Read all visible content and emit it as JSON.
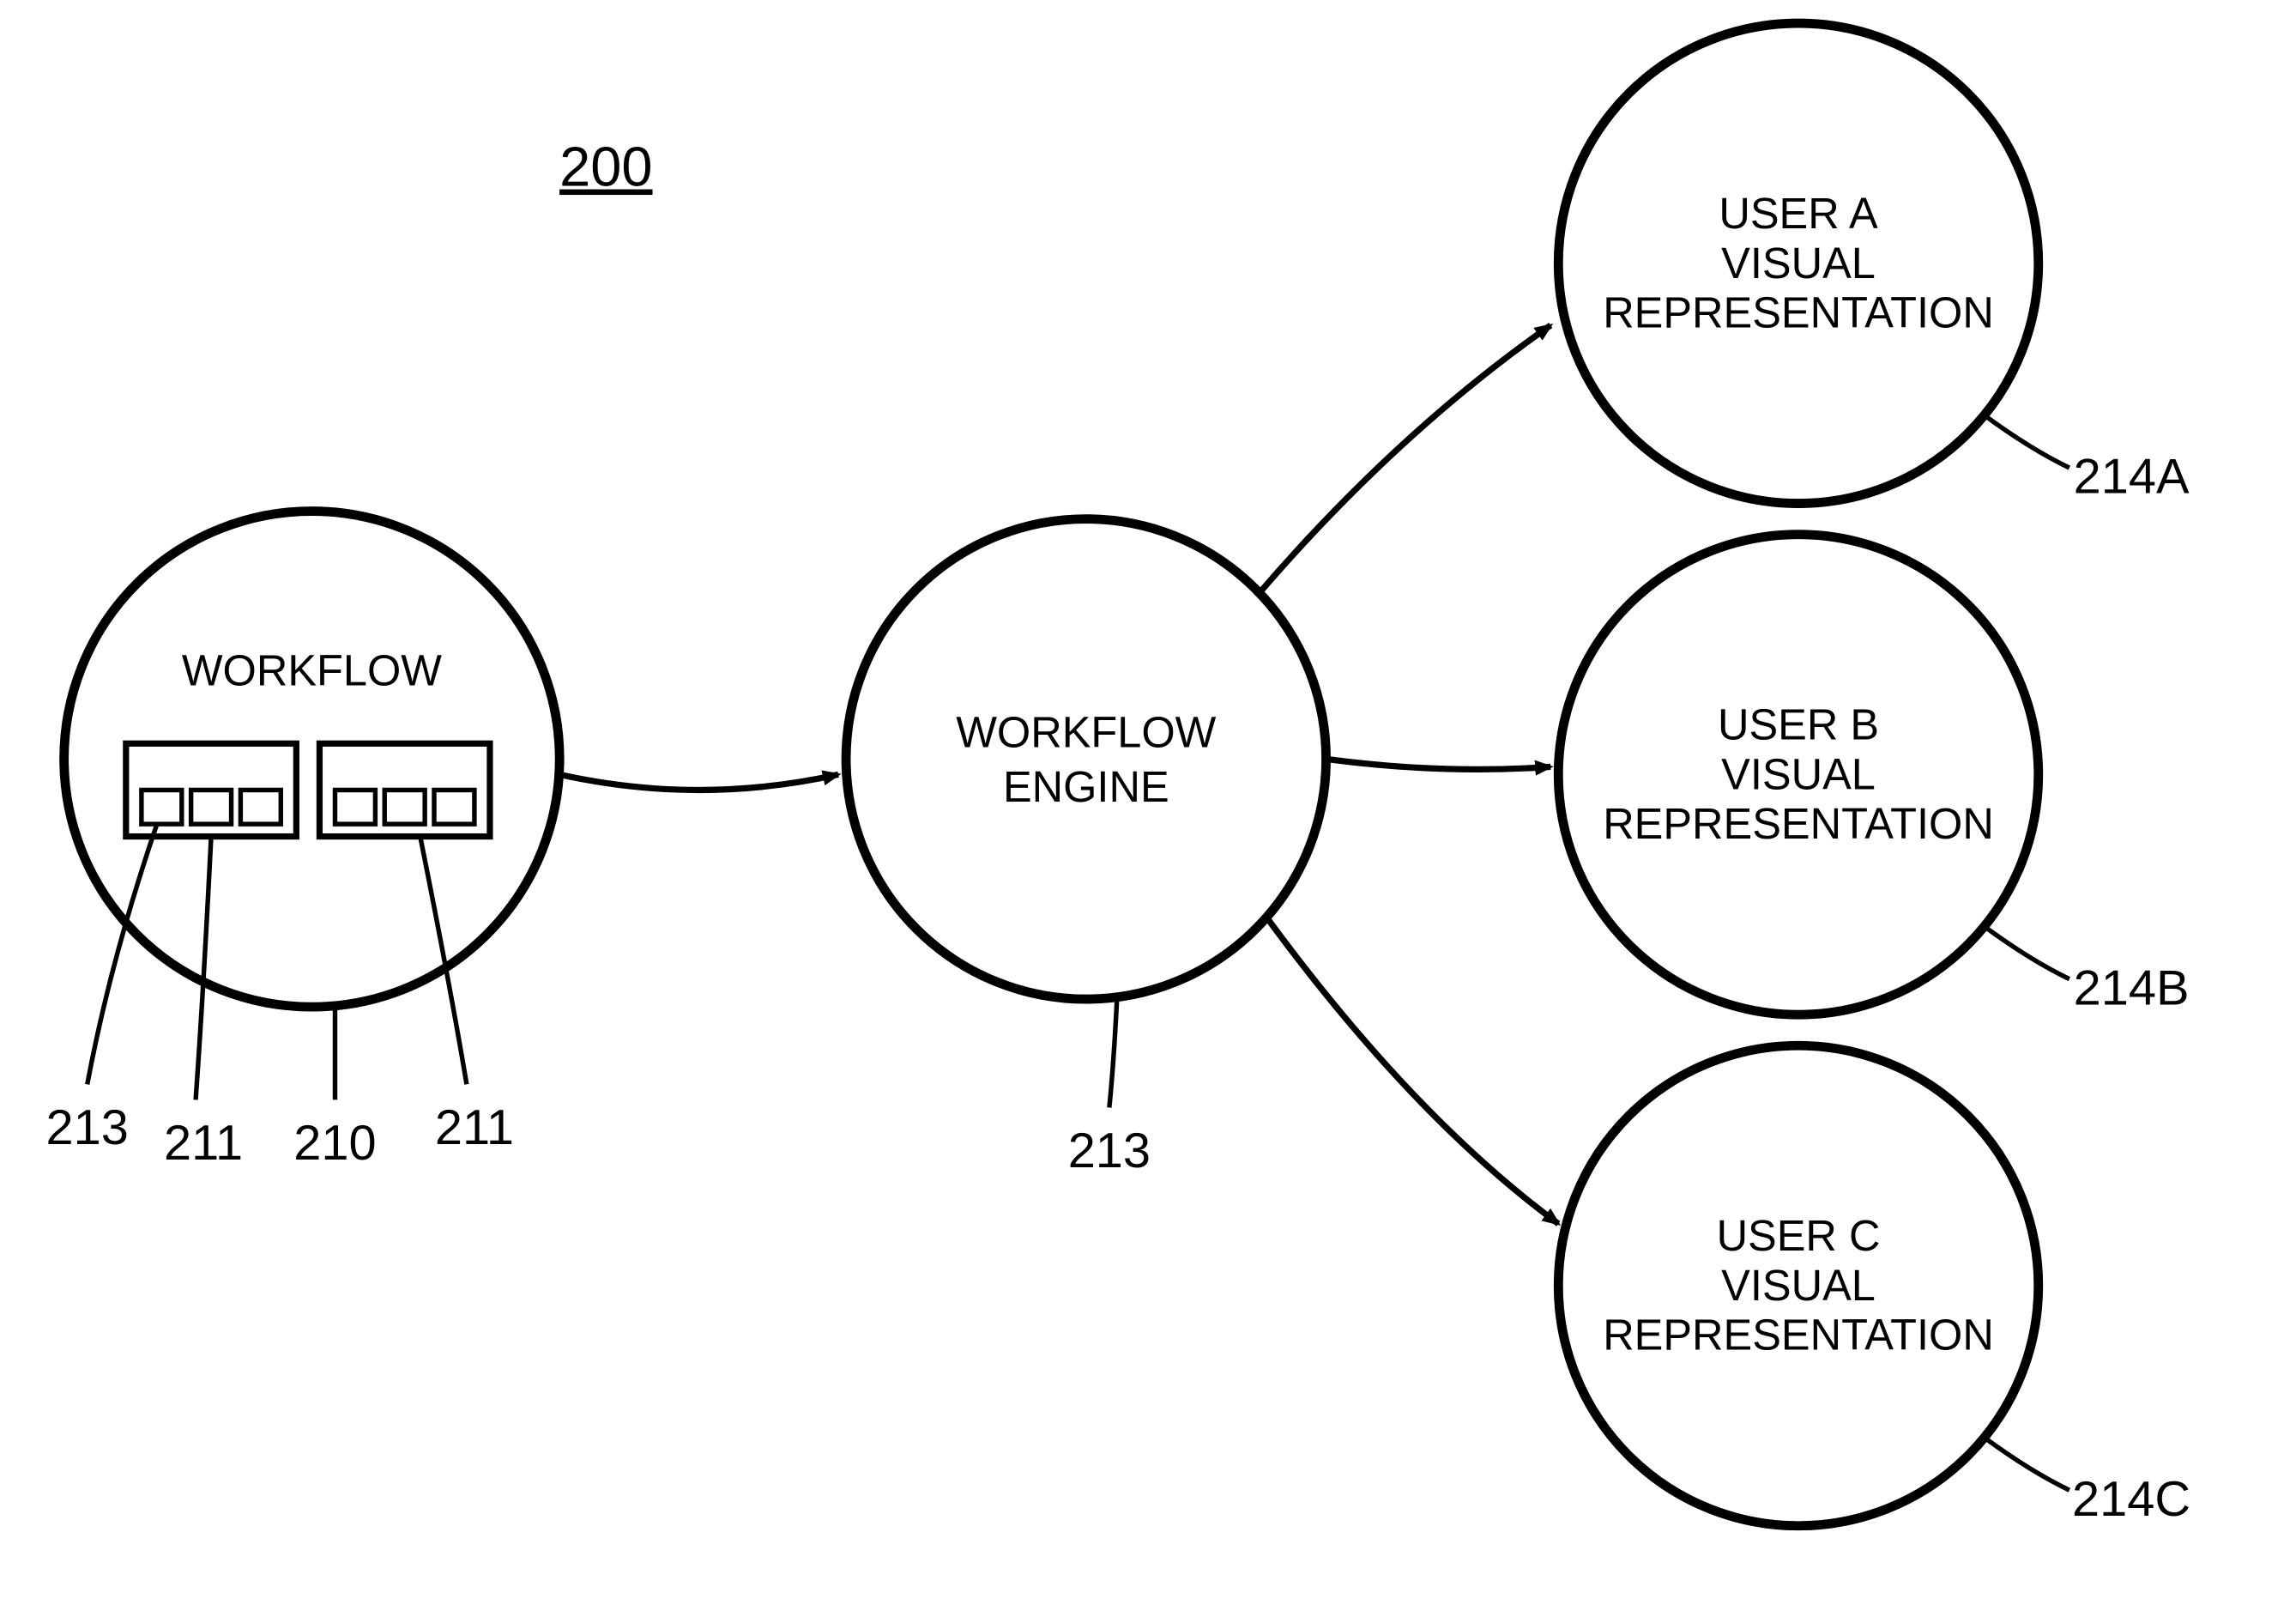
{
  "figure_number": "200",
  "nodes": {
    "workflow": {
      "label": "WORKFLOW",
      "ref_bubble": "210"
    },
    "engine": {
      "label_l1": "WORKFLOW",
      "label_l2": "ENGINE",
      "ref": "213"
    },
    "userA": {
      "l1": "USER A",
      "l2": "VISUAL",
      "l3": "REPRESENTATION",
      "ref": "214A"
    },
    "userB": {
      "l1": "USER B",
      "l2": "VISUAL",
      "l3": "REPRESENTATION",
      "ref": "214B"
    },
    "userC": {
      "l1": "USER C",
      "l2": "VISUAL",
      "l3": "REPRESENTATION",
      "ref": "214C"
    }
  },
  "sub_refs": {
    "box_left": "211",
    "box_right": "211",
    "cell": "213"
  }
}
